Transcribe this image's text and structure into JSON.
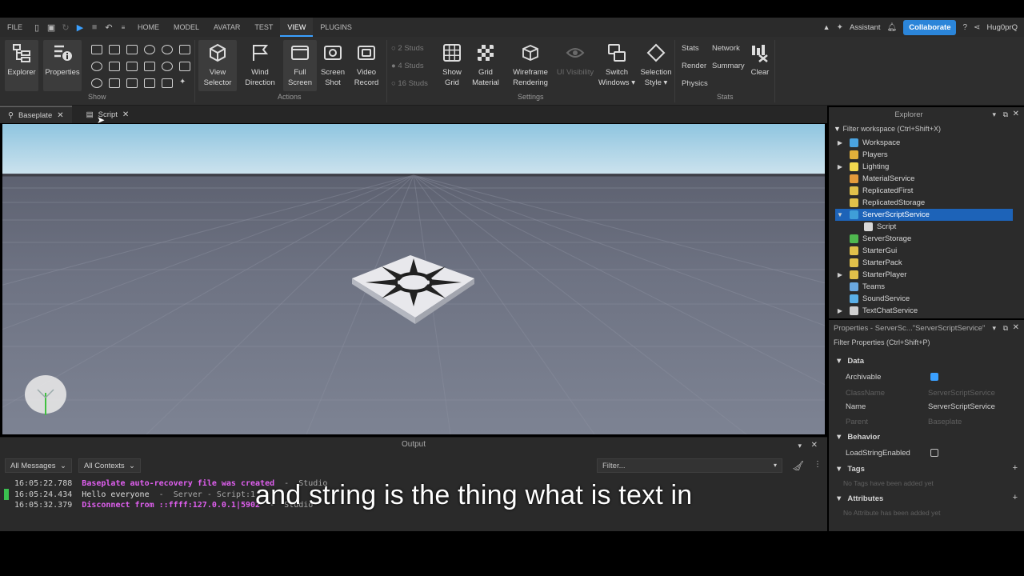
{
  "menubar": {
    "file": "FILE",
    "tabs": [
      "HOME",
      "MODEL",
      "AVATAR",
      "TEST",
      "VIEW",
      "PLUGINS"
    ],
    "active_tab": "VIEW",
    "assistant": "Assistant",
    "collaborate": "Collaborate",
    "user": "Hug0prQ"
  },
  "ribbon": {
    "explorer": "Explorer",
    "properties": "Properties",
    "show_group": "Show",
    "view_selector": [
      "View",
      "Selector"
    ],
    "wind_direction": [
      "Wind",
      "Direction"
    ],
    "full_screen": [
      "Full",
      "Screen"
    ],
    "screen_shot": [
      "Screen",
      "Shot"
    ],
    "video_record": [
      "Video",
      "Record"
    ],
    "actions_group": "Actions",
    "studs": [
      "2 Studs",
      "4 Studs",
      "16 Studs"
    ],
    "show_grid": [
      "Show",
      "Grid"
    ],
    "grid_material": [
      "Grid",
      "Material"
    ],
    "wireframe_rendering": [
      "Wireframe",
      "Rendering"
    ],
    "ui_visibility": "UI Visibility",
    "switch_windows": [
      "Switch",
      "Windows ▾"
    ],
    "selection_style": [
      "Selection",
      "Style ▾"
    ],
    "settings_group": "Settings",
    "stats_items": [
      "Stats",
      "Network",
      "Render",
      "Summary",
      "Physics"
    ],
    "clear": "Clear",
    "stats_group": "Stats"
  },
  "doc_tabs": [
    "Baseplate",
    "Script"
  ],
  "output": {
    "title": "Output",
    "messages_filter": "All Messages",
    "contexts_filter": "All Contexts",
    "filter_placeholder": "Filter...",
    "lines": [
      {
        "time": "16:05:22.788",
        "text": "Baseplate auto-recovery file was created",
        "sep": "  -  ",
        "src": "Studio"
      },
      {
        "time": "16:05:24.434",
        "text": "Hello everyone",
        "sep": "  -  ",
        "src": "Server - Script:1"
      },
      {
        "time": "16:05:32.379",
        "text": "Disconnect from ::ffff:127.0.0.1|5902",
        "sep": "  -  ",
        "src": "Studio"
      }
    ]
  },
  "explorer": {
    "title": "Explorer",
    "filter": "Filter workspace (Ctrl+Shift+X)",
    "items": [
      {
        "label": "Workspace",
        "arrow": "▶",
        "color": "#4aa3e0"
      },
      {
        "label": "Players",
        "arrow": "",
        "color": "#e2b03a"
      },
      {
        "label": "Lighting",
        "arrow": "▶",
        "color": "#f2d94e"
      },
      {
        "label": "MaterialService",
        "arrow": "",
        "color": "#e49a3b"
      },
      {
        "label": "ReplicatedFirst",
        "arrow": "",
        "color": "#e0c04a"
      },
      {
        "label": "ReplicatedStorage",
        "arrow": "",
        "color": "#e0c04a"
      },
      {
        "label": "ServerScriptService",
        "arrow": "▼",
        "color": "#3f9ed8"
      },
      {
        "label": "Script",
        "arrow": "",
        "color": "#d8d8d8",
        "child": true
      },
      {
        "label": "ServerStorage",
        "arrow": "",
        "color": "#4fb84f"
      },
      {
        "label": "StarterGui",
        "arrow": "",
        "color": "#e0c04a"
      },
      {
        "label": "StarterPack",
        "arrow": "",
        "color": "#e0c04a"
      },
      {
        "label": "StarterPlayer",
        "arrow": "▶",
        "color": "#e0c04a"
      },
      {
        "label": "Teams",
        "arrow": "",
        "color": "#6aa8e0"
      },
      {
        "label": "SoundService",
        "arrow": "",
        "color": "#5ab0e8"
      },
      {
        "label": "TextChatService",
        "arrow": "▶",
        "color": "#d0d0d0"
      }
    ],
    "selected": "ServerScriptService"
  },
  "properties": {
    "title": "Properties - ServerSc...\"ServerScriptService\"",
    "filter": "Filter Properties (Ctrl+Shift+P)",
    "data_section": "Data",
    "archivable": "Archivable",
    "classname_label": "ClassName",
    "classname_value": "ServerScriptService",
    "name_label": "Name",
    "name_value": "ServerScriptService",
    "parent_label": "Parent",
    "parent_value": "Baseplate",
    "behavior_section": "Behavior",
    "loadstring": "LoadStringEnabled",
    "tags_section": "Tags",
    "tags_empty": "No Tags have been added yet",
    "attributes_section": "Attributes",
    "attributes_empty": "No Attribute has been added yet"
  },
  "caption": "and string is the thing what is text in"
}
